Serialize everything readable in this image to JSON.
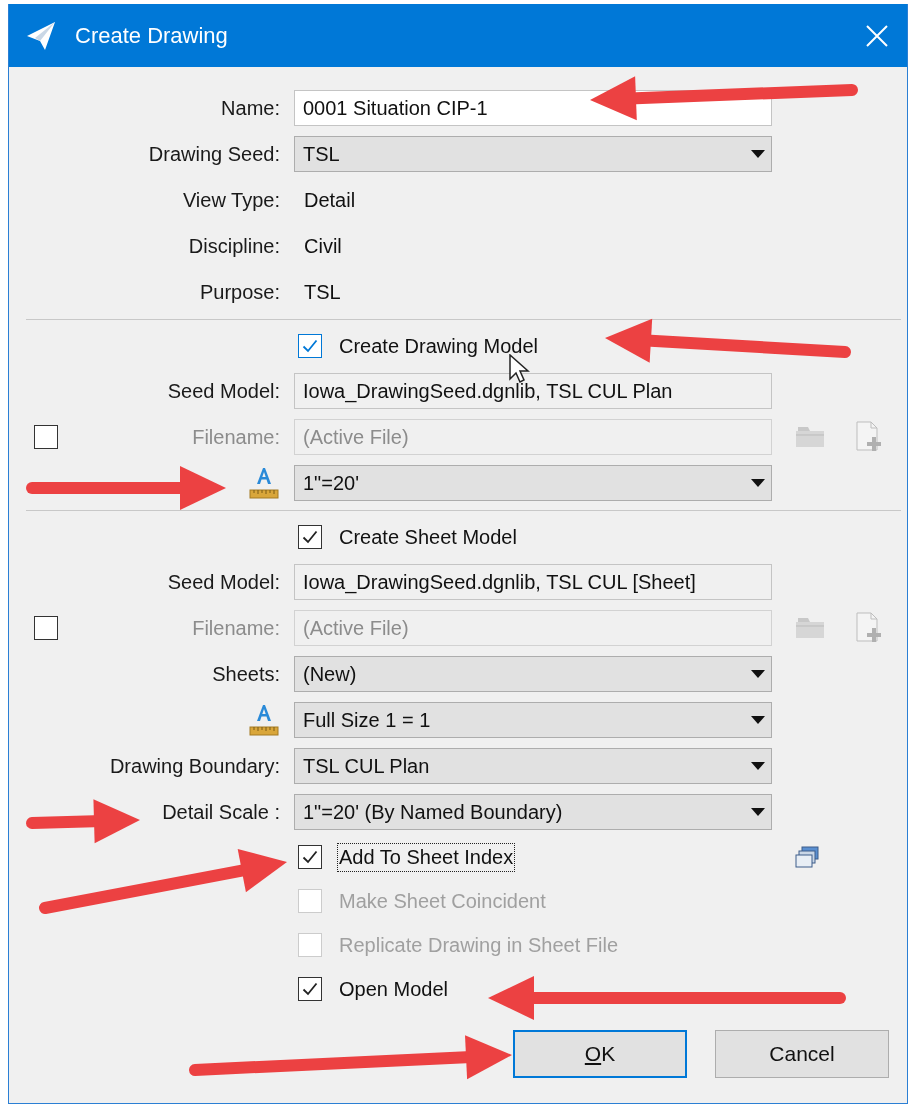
{
  "window": {
    "title": "Create Drawing"
  },
  "sections": [
    {
      "rows": [
        {
          "kind": "input",
          "label": "Name:",
          "value": "0001 Situation CIP-1"
        },
        {
          "kind": "select",
          "label": "Drawing Seed:",
          "value": "TSL"
        },
        {
          "kind": "info",
          "label": "View Type:",
          "value": "Detail"
        },
        {
          "kind": "info",
          "label": "Discipline:",
          "value": "Civil"
        },
        {
          "kind": "info",
          "label": "Purpose:",
          "value": "TSL"
        }
      ]
    },
    {
      "rows": [
        {
          "kind": "check",
          "label": "Create Drawing Model",
          "checked": true,
          "disabled": false,
          "hover": true,
          "focused": false
        },
        {
          "kind": "readonly",
          "label": "Seed Model:",
          "value": "Iowa_DrawingSeed.dgnlib, TSL CUL Plan"
        },
        {
          "kind": "file",
          "label": "Filename:",
          "placeholder": "(Active File)",
          "option_checked": false
        },
        {
          "kind": "scale",
          "value": "1\"=20'"
        }
      ]
    },
    {
      "rows": [
        {
          "kind": "check",
          "label": "Create Sheet Model",
          "checked": true,
          "disabled": false,
          "focused": false
        },
        {
          "kind": "readonly",
          "label": "Seed Model:",
          "value": "Iowa_DrawingSeed.dgnlib, TSL CUL [Sheet]"
        },
        {
          "kind": "file",
          "label": "Filename:",
          "placeholder": "(Active File)",
          "option_checked": false
        },
        {
          "kind": "select",
          "label": "Sheets:",
          "value": "(New)"
        },
        {
          "kind": "scale",
          "value": "Full Size 1 = 1"
        },
        {
          "kind": "select",
          "label": "Drawing Boundary:",
          "value": "TSL CUL Plan"
        },
        {
          "kind": "select",
          "label": "Detail Scale :",
          "value": "1\"=20' (By Named Boundary)"
        },
        {
          "kind": "check-index",
          "label": "Add To Sheet Index",
          "checked": true,
          "disabled": false,
          "focused": true
        },
        {
          "kind": "check",
          "label": "Make Sheet Coincident",
          "checked": false,
          "disabled": true,
          "focused": false
        },
        {
          "kind": "check",
          "label": "Replicate Drawing in Sheet File",
          "checked": false,
          "disabled": true,
          "focused": false
        },
        {
          "kind": "check",
          "label": "Open Model",
          "checked": true,
          "disabled": false,
          "focused": false
        }
      ]
    }
  ],
  "buttons": [
    {
      "label": "OK",
      "default": true,
      "underline_first": true
    },
    {
      "label": "Cancel",
      "default": false,
      "underline_first": false
    }
  ]
}
